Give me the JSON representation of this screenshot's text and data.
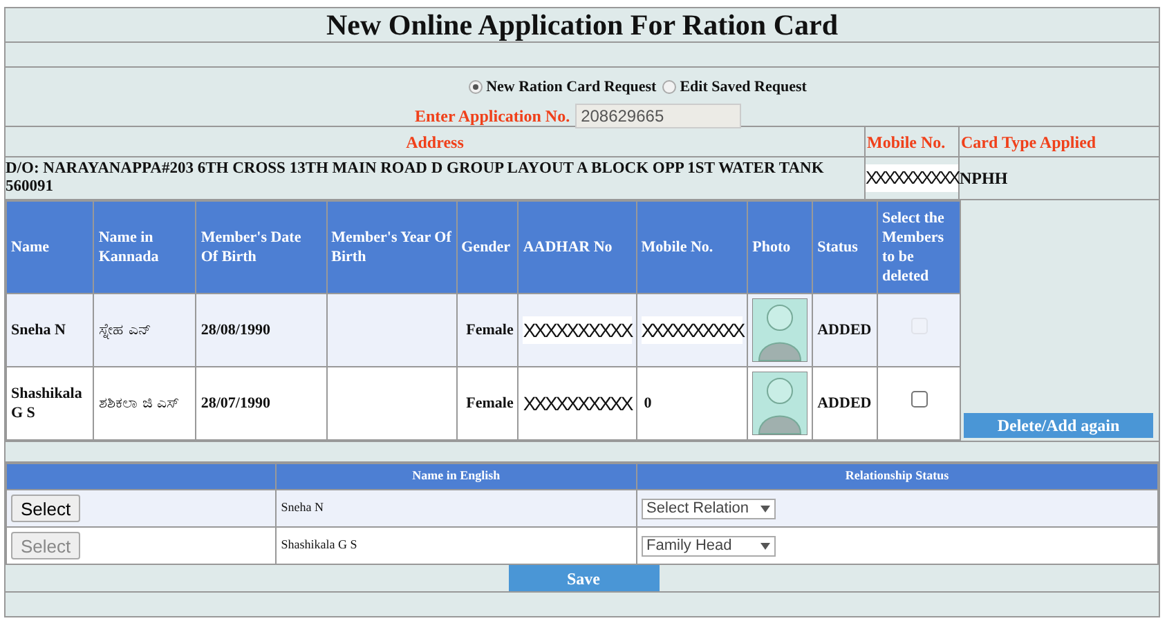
{
  "title": "New Online Application For Ration Card",
  "request_options": [
    {
      "label": "New Ration Card Request",
      "selected": true
    },
    {
      "label": "Edit Saved Request",
      "selected": false
    }
  ],
  "application_no": {
    "label": "Enter Application No.",
    "value": "208629665"
  },
  "applicant": {
    "columns": [
      "Address",
      "Mobile No.",
      "Card Type Applied"
    ],
    "address": "D/O: NARAYANAPPA#203 6TH CROSS 13TH MAIN ROAD D GROUP LAYOUT A BLOCK OPP 1ST WATER TANK 560091",
    "mobile": "XXXXXXXXXX",
    "card_type": "NPHH"
  },
  "members": {
    "columns": [
      "Name",
      "Name in Kannada",
      "Member's Date Of Birth",
      "Member's Year Of Birth",
      "Gender",
      "AADHAR No",
      "Mobile No.",
      "Photo",
      "Status",
      "Select the Members to be deleted"
    ],
    "rows": [
      {
        "name": "Sneha N",
        "name_kannada": "ಸ್ನೇಹ ಎನ್",
        "dob": "28/08/1990",
        "gender": "Female",
        "aadhar": "XXXXXXXXXX",
        "mobile": "XXXXXXXXXX",
        "kind": "field",
        "status": "ADDED",
        "checked": false,
        "disabled": true
      },
      {
        "name": "Shashikala G S",
        "name_kannada": "ಶಶಿಕಲಾ ಜಿ ಎಸ್",
        "dob": "28/07/1990",
        "gender": "Female",
        "aadhar": "XXXXXXXXXX",
        "mobile": "0",
        "kind": "text",
        "status": "ADDED",
        "checked": false,
        "disabled": false
      }
    ]
  },
  "delete_button": "Delete/Add again",
  "relations": {
    "columns": [
      "Name in English",
      "Relationship Status"
    ],
    "rows": [
      {
        "button": "Select",
        "disabled": false,
        "name": "Sneha N",
        "relation": "Select Relation"
      },
      {
        "button": "Select",
        "disabled": true,
        "name": "Shashikala G S",
        "relation": "Family Head"
      }
    ]
  },
  "save_button": "Save"
}
